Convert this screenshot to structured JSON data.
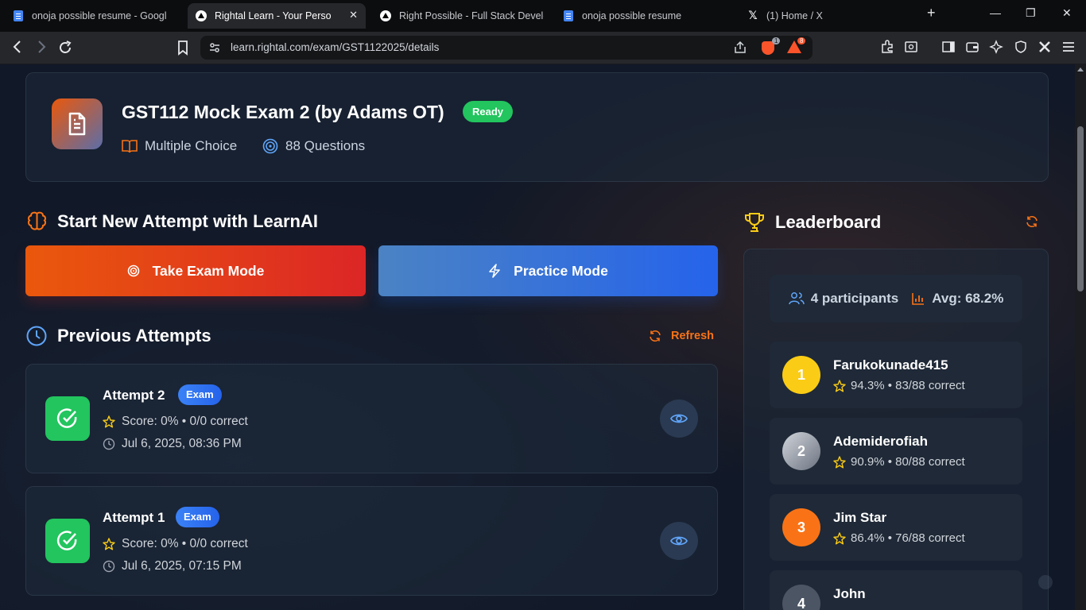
{
  "browser": {
    "tabs": [
      {
        "label": "onoja possible resume - Google D",
        "icon": "google-docs-icon"
      },
      {
        "label": "Rightal Learn - Your Personal",
        "icon": "rightal-icon",
        "active": true
      },
      {
        "label": "Right Possible - Full Stack Develop",
        "icon": "rightal-icon"
      },
      {
        "label": "onoja possible resume",
        "icon": "google-docs-icon"
      },
      {
        "label": "(1) Home / X",
        "icon": "x-icon"
      }
    ],
    "url": "learn.rightal.com/exam/GST1122025/details",
    "shield_count": "1",
    "rewards_count": "8"
  },
  "exam": {
    "title": "GST112 Mock Exam 2 (by Adams OT)",
    "status": "Ready",
    "type": "Multiple Choice",
    "questions": "88 Questions"
  },
  "start": {
    "title": "Start New Attempt with LearnAI",
    "exam_mode": "Take Exam Mode",
    "practice_mode": "Practice Mode"
  },
  "previous": {
    "title": "Previous Attempts",
    "refresh": "Refresh",
    "attempts": [
      {
        "title": "Attempt 2",
        "badge": "Exam",
        "score": "Score: 0% • 0/0 correct",
        "date": "Jul 6, 2025, 08:36 PM"
      },
      {
        "title": "Attempt 1",
        "badge": "Exam",
        "score": "Score: 0% • 0/0 correct",
        "date": "Jul 6, 2025, 07:15 PM"
      }
    ]
  },
  "leaderboard": {
    "title": "Leaderboard",
    "participants": "4 participants",
    "average": "Avg: 68.2%",
    "entries": [
      {
        "rank": "1",
        "name": "Farukokunade415",
        "score": "94.3% • 83/88 correct",
        "color": "#facc15"
      },
      {
        "rank": "2",
        "name": "Ademiderofiah",
        "score": "90.9% • 80/88 correct",
        "color": "#9ca3af"
      },
      {
        "rank": "3",
        "name": "Jim Star",
        "score": "86.4% • 76/88 correct",
        "color": "#f97316"
      },
      {
        "rank": "4",
        "name": "John",
        "score": "",
        "color": "#4b5563"
      }
    ]
  },
  "colors": {
    "accent": "#f97316",
    "success": "#22c55e",
    "primary": "#2563eb"
  }
}
